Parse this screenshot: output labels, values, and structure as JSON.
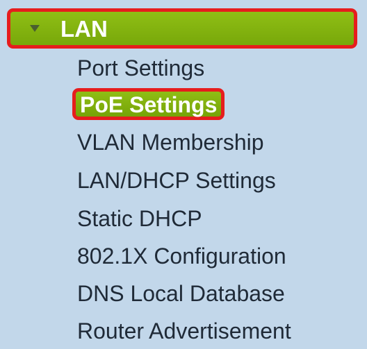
{
  "section": {
    "label": "LAN",
    "expanded_icon": "triangle-down-icon"
  },
  "menu": {
    "items": [
      {
        "label": "Port Settings",
        "active": false
      },
      {
        "label": "PoE Settings",
        "active": true
      },
      {
        "label": "VLAN Membership",
        "active": false
      },
      {
        "label": "LAN/DHCP Settings",
        "active": false
      },
      {
        "label": "Static DHCP",
        "active": false
      },
      {
        "label": "802.1X Configuration",
        "active": false
      },
      {
        "label": "DNS Local Database",
        "active": false
      },
      {
        "label": "Router Advertisement",
        "active": false
      }
    ]
  },
  "colors": {
    "panel_background": "#c2d7ea",
    "header_green": "#85b510",
    "highlight_border": "#e61d1d",
    "item_text": "#1f2a37"
  }
}
